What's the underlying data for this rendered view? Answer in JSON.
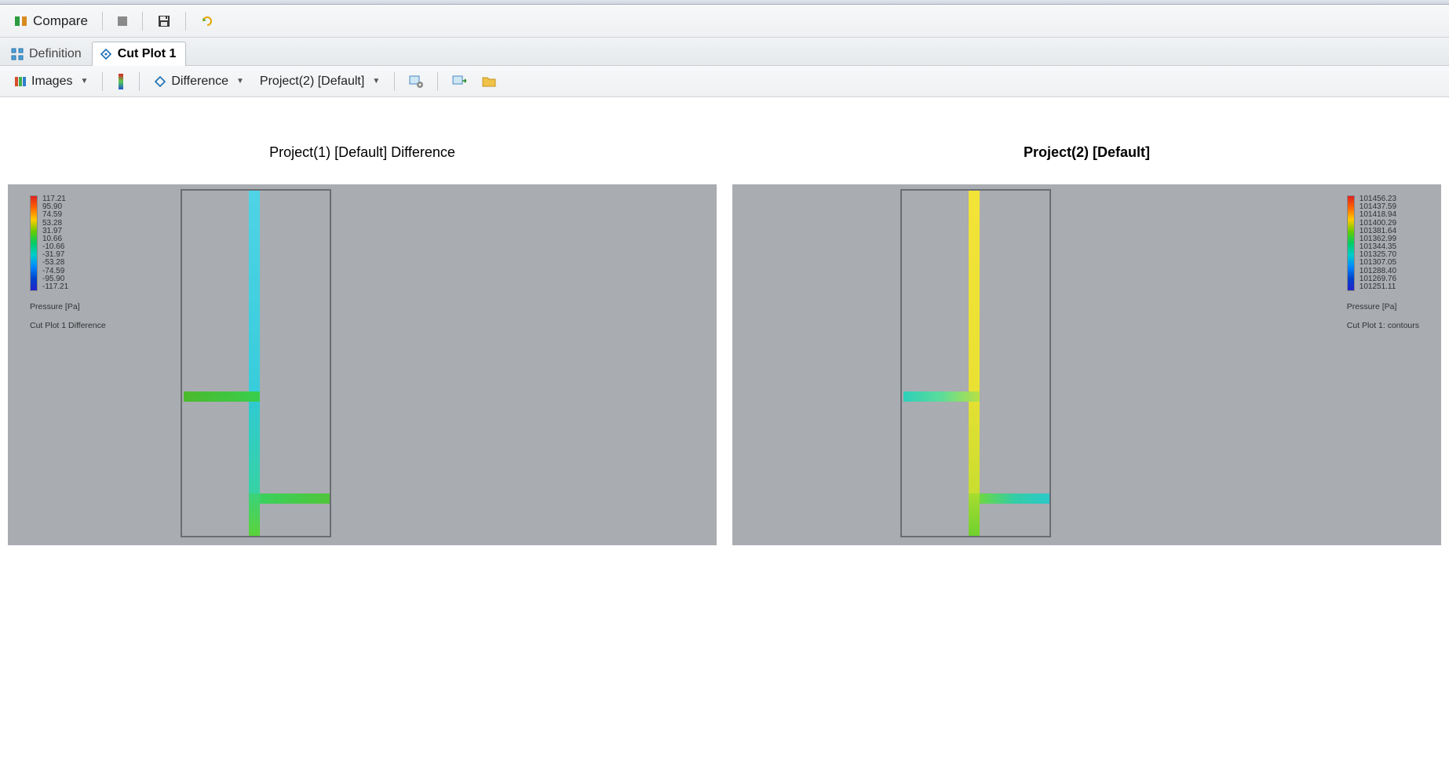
{
  "toolbar": {
    "compare_label": "Compare"
  },
  "tabs": {
    "definition_label": "Definition",
    "cutplot_label": "Cut Plot 1"
  },
  "subtoolbar": {
    "images_label": "Images",
    "mode_label": "Difference",
    "project_label": "Project(2) [Default]"
  },
  "panels": {
    "left_title": "Project(1) [Default] Difference",
    "right_title": "Project(2) [Default]"
  },
  "legend_left": {
    "values": [
      "117.21",
      "95.90",
      "74.59",
      "53.28",
      "31.97",
      "10.66",
      "-10.66",
      "-31.97",
      "-53.28",
      "-74.59",
      "-95.90",
      "-117.21"
    ],
    "caption": "Pressure [Pa]",
    "sub": "Cut Plot 1 Difference"
  },
  "legend_right": {
    "values": [
      "101456.23",
      "101437.59",
      "101418.94",
      "101400.29",
      "101381.64",
      "101362.99",
      "101344.35",
      "101325.70",
      "101307.05",
      "101288.40",
      "101269.76",
      "101251.11"
    ],
    "caption": "Pressure [Pa]",
    "sub": "Cut Plot 1: contours"
  },
  "chart_data": [
    {
      "type": "heatmap",
      "title": "Project(1) [Default] Difference",
      "variable": "Pressure [Pa]",
      "plot": "Cut Plot 1 Difference",
      "colorbar_range": [
        -117.21,
        117.21
      ],
      "colorbar_ticks": [
        117.21,
        95.9,
        74.59,
        53.28,
        31.97,
        10.66,
        -10.66,
        -31.97,
        -53.28,
        -74.59,
        -95.9,
        -117.21
      ]
    },
    {
      "type": "heatmap",
      "title": "Project(2) [Default]",
      "variable": "Pressure [Pa]",
      "plot": "Cut Plot 1: contours",
      "colorbar_range": [
        101251.11,
        101456.23
      ],
      "colorbar_ticks": [
        101456.23,
        101437.59,
        101418.94,
        101400.29,
        101381.64,
        101362.99,
        101344.35,
        101325.7,
        101307.05,
        101288.4,
        101269.76,
        101251.11
      ]
    }
  ]
}
